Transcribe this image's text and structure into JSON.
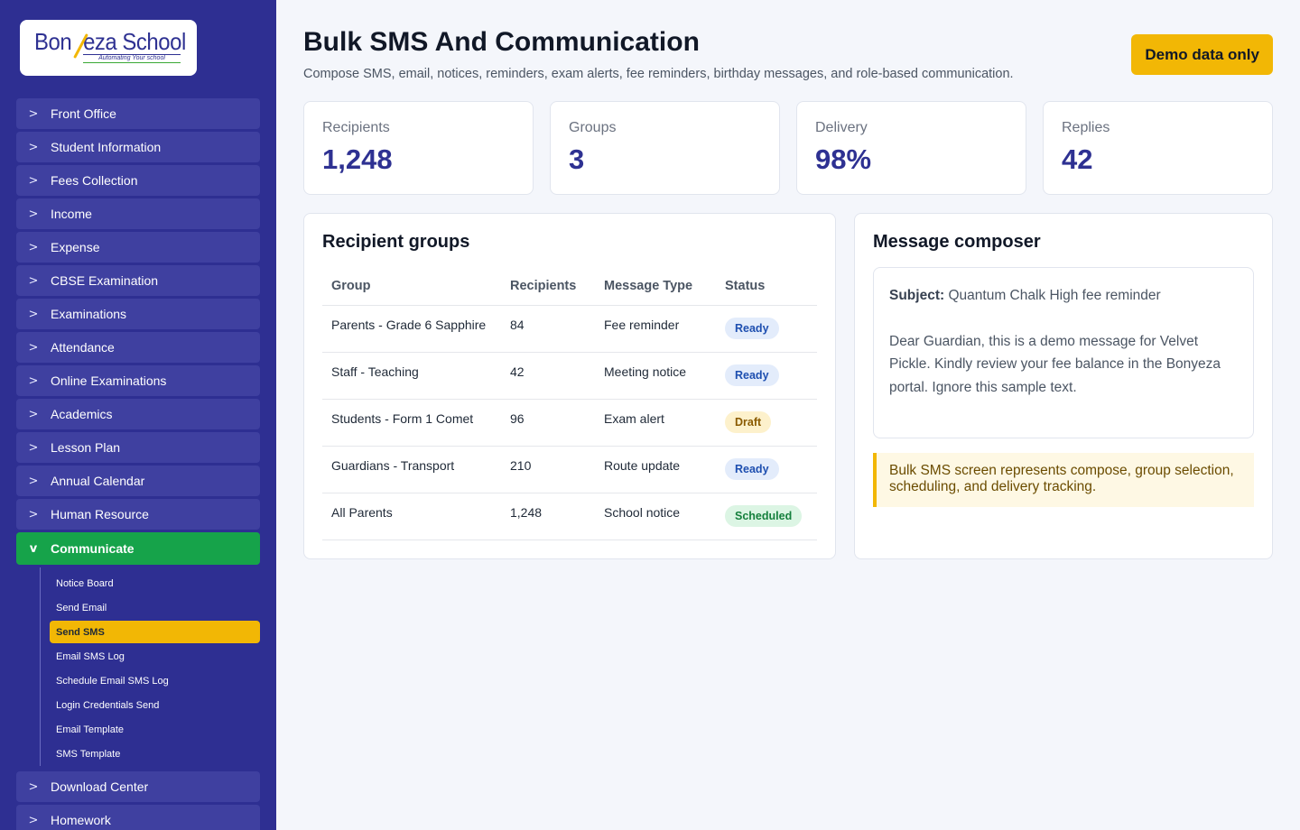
{
  "brand": {
    "name_part1": "Bon",
    "name_part2": "eza School",
    "tagline": "Automating Your school"
  },
  "sidebar": {
    "items_top": [
      {
        "label": "Front Office",
        "chevron": ">"
      },
      {
        "label": "Student Information",
        "chevron": ">"
      },
      {
        "label": "Fees Collection",
        "chevron": ">"
      },
      {
        "label": "Income",
        "chevron": ">"
      },
      {
        "label": "Expense",
        "chevron": ">"
      },
      {
        "label": "CBSE Examination",
        "chevron": ">"
      },
      {
        "label": "Examinations",
        "chevron": ">"
      },
      {
        "label": "Attendance",
        "chevron": ">"
      },
      {
        "label": "Online Examinations",
        "chevron": ">"
      },
      {
        "label": "Academics",
        "chevron": ">"
      },
      {
        "label": "Lesson Plan",
        "chevron": ">"
      },
      {
        "label": "Annual Calendar",
        "chevron": ">"
      },
      {
        "label": "Human Resource",
        "chevron": ">"
      }
    ],
    "active_item": {
      "label": "Communicate",
      "chevron": "v"
    },
    "sub_items": [
      {
        "label": "Notice Board"
      },
      {
        "label": "Send Email"
      },
      {
        "label": "Send SMS"
      },
      {
        "label": "Email SMS Log"
      },
      {
        "label": "Schedule Email SMS Log"
      },
      {
        "label": "Login Credentials Send"
      },
      {
        "label": "Email Template"
      },
      {
        "label": "SMS Template"
      }
    ],
    "active_sub_item": "Send SMS",
    "items_bottom": [
      {
        "label": "Download Center",
        "chevron": ">"
      },
      {
        "label": "Homework",
        "chevron": ">"
      }
    ]
  },
  "header": {
    "title": "Bulk SMS And Communication",
    "subtitle": "Compose SMS, email, notices, reminders, exam alerts, fee reminders, birthday messages, and role-based communication.",
    "demo_label": "Demo data only"
  },
  "stats": [
    {
      "label": "Recipients",
      "value": "1,248"
    },
    {
      "label": "Groups",
      "value": "3"
    },
    {
      "label": "Delivery",
      "value": "98%"
    },
    {
      "label": "Replies",
      "value": "42"
    }
  ],
  "recipient_groups": {
    "title": "Recipient groups",
    "columns": [
      "Group",
      "Recipients",
      "Message Type",
      "Status"
    ],
    "rows": [
      {
        "group": "Parents - Grade 6 Sapphire",
        "recipients": "84",
        "type": "Fee reminder",
        "status": "Ready"
      },
      {
        "group": "Staff - Teaching",
        "recipients": "42",
        "type": "Meeting notice",
        "status": "Ready"
      },
      {
        "group": "Students - Form 1 Comet",
        "recipients": "96",
        "type": "Exam alert",
        "status": "Draft"
      },
      {
        "group": "Guardians - Transport",
        "recipients": "210",
        "type": "Route update",
        "status": "Ready"
      },
      {
        "group": "All Parents",
        "recipients": "1,248",
        "type": "School notice",
        "status": "Scheduled"
      }
    ]
  },
  "composer": {
    "title": "Message composer",
    "subject_label": "Subject:",
    "subject": "Quantum Chalk High fee reminder",
    "body": "Dear Guardian, this is a demo message for Velvet Pickle. Kindly review your fee balance in the Bonyeza portal. Ignore this sample text.",
    "note": "Bulk SMS screen represents compose, group selection, scheduling, and delivery tracking."
  },
  "colors": {
    "sidebar_bg": "#2e2f92",
    "nav_item_bg": "#3f40a0",
    "active_green": "#16a34a",
    "accent_yellow": "#f2b705",
    "stat_value": "#2e3192"
  }
}
